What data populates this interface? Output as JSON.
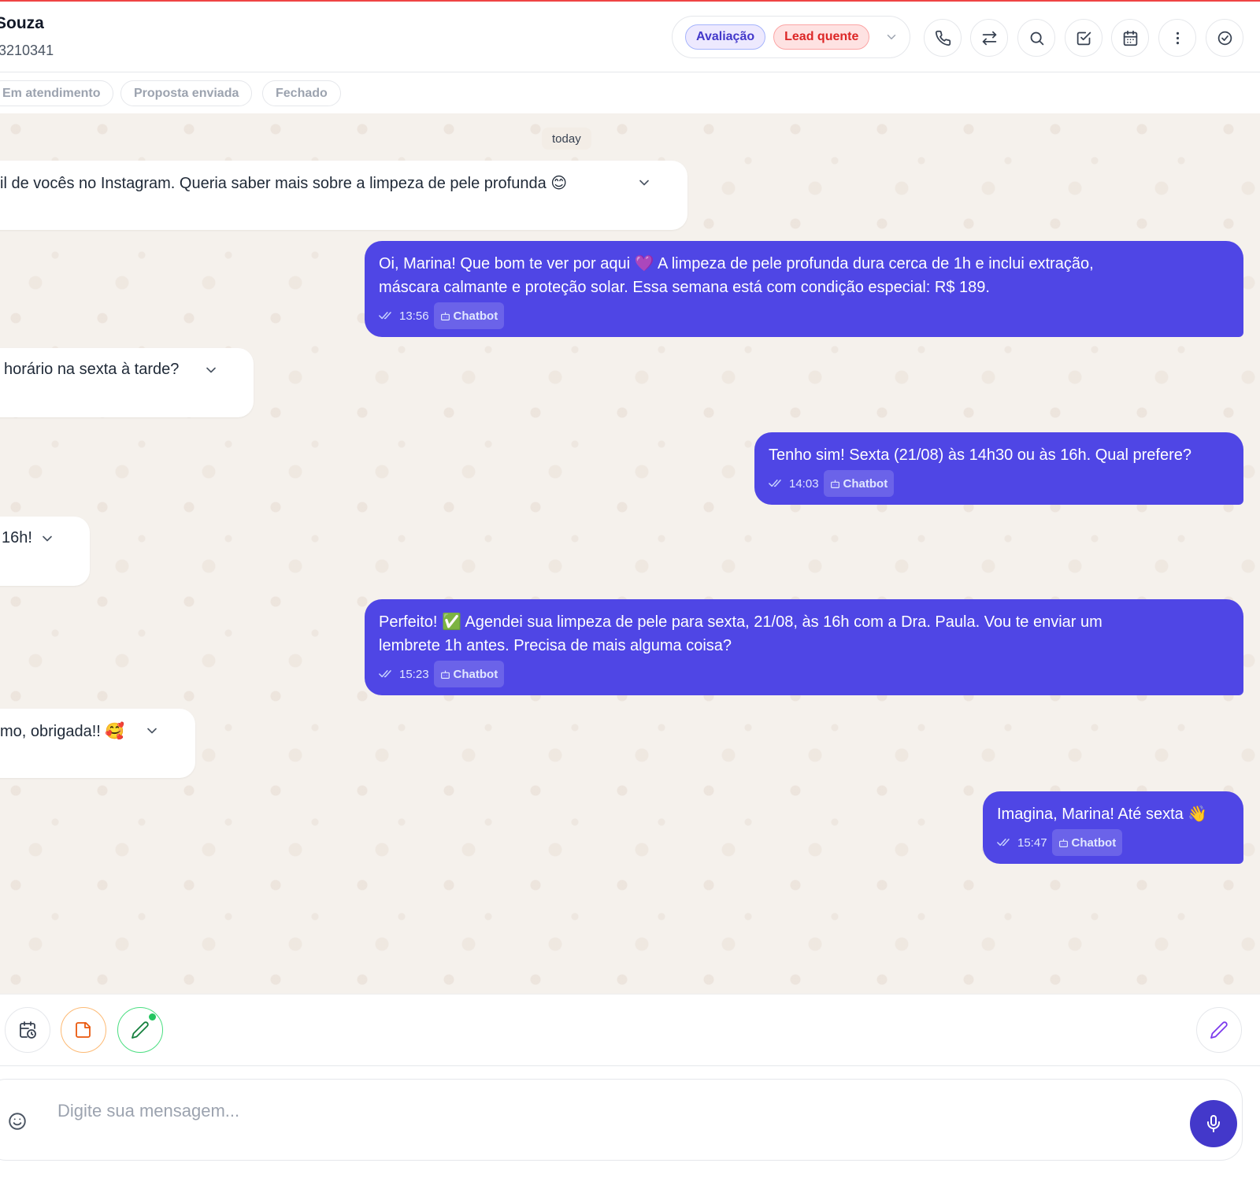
{
  "header": {
    "contact_name": "Souza",
    "contact_phone": "3210341",
    "tags": [
      "Avaliação",
      "Lead quente"
    ]
  },
  "stages": [
    "Em atendimento",
    "Proposta enviada",
    "Fechado"
  ],
  "chat": {
    "date_label": "today",
    "incoming": [
      "il de vocês no Instagram. Queria saber mais sobre a limpeza de pele profunda 😊",
      "horário na sexta à tarde?",
      "16h!",
      "mo, obrigada!! 🥰"
    ],
    "outgoing": [
      {
        "line1": "Oi, Marina! Que bom te ver por aqui 💜  A limpeza de pele profunda dura cerca de 1h e inclui extração,",
        "line2": "máscara calmante e proteção solar. Essa semana está com condição especial: R$ 189.",
        "time": "13:56",
        "badge": "Chatbot"
      },
      {
        "line1": "Tenho sim! Sexta (21/08) às 14h30 ou às 16h. Qual prefere?",
        "time": "14:03",
        "badge": "Chatbot"
      },
      {
        "line1": "Perfeito! ✅  Agendei sua limpeza de pele para sexta, 21/08, às 16h com a Dra. Paula. Vou te enviar um",
        "line2": "lembrete 1h antes. Precisa de mais alguma coisa?",
        "time": "15:23",
        "badge": "Chatbot"
      },
      {
        "line1": "Imagina, Marina! Até sexta 👋",
        "time": "15:47",
        "badge": "Chatbot"
      }
    ]
  },
  "composer": {
    "placeholder": "Digite sua mensagem..."
  },
  "colors": {
    "accent": "#4f46e5",
    "tag_purple": "#4338ca",
    "tag_red": "#dc2626",
    "chat_bg": "#f5f1ec"
  },
  "icons": {
    "header": [
      "phone-icon",
      "transfer-icon",
      "search-icon",
      "task-check-icon",
      "calendar-icon",
      "more-vertical-icon",
      "resolve-check-icon"
    ],
    "toolbar": [
      "schedule-icon",
      "note-icon",
      "edit-pencil-icon",
      "signature-pencil-icon"
    ]
  }
}
